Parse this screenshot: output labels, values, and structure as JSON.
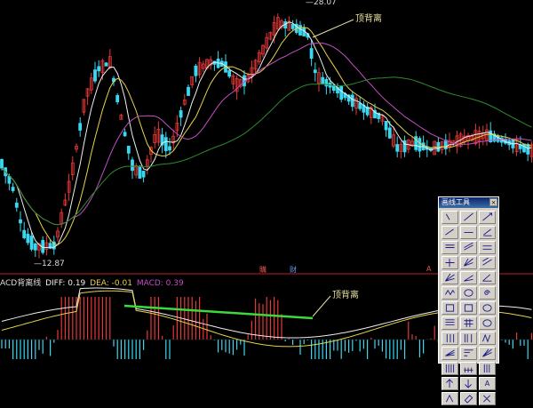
{
  "labels": {
    "price_high": "28.07",
    "price_low": "12.87",
    "top_divergence_upper": "顶背离",
    "top_divergence_lower": "顶背离",
    "macd_prefix": "ACD背离线",
    "diff": "DIFF: 0.19",
    "dea": "DEA: -0.01",
    "macd": "MACD: 0.39",
    "marker_1": "購",
    "marker_2": "财",
    "marker_3": "A"
  },
  "toolbox": {
    "title": "画线工具",
    "close": "×",
    "buttons": [
      {
        "name": "cursor-icon"
      },
      {
        "name": "line-icon"
      },
      {
        "name": "ray-icon"
      },
      {
        "name": "segment-icon"
      },
      {
        "name": "dashed-line-icon"
      },
      {
        "name": "arrow-line-icon"
      },
      {
        "name": "horizontal-line-icon"
      },
      {
        "name": "channel-icon"
      },
      {
        "name": "parallel-lines-icon"
      },
      {
        "name": "price-line-icon"
      },
      {
        "name": "fan-lines-icon"
      },
      {
        "name": "trend-channel-icon"
      },
      {
        "name": "gann-fan-icon"
      },
      {
        "name": "fib-fan-icon"
      },
      {
        "name": "angle-icon"
      },
      {
        "name": "wave-icon"
      },
      {
        "name": "circle-icon"
      },
      {
        "name": "spiral-icon"
      },
      {
        "name": "rectangle-icon"
      },
      {
        "name": "box-icon"
      },
      {
        "name": "ellipse-icon"
      },
      {
        "name": "fib-retrace-icon"
      },
      {
        "name": "grid-icon"
      },
      {
        "name": "cycle-icon"
      },
      {
        "name": "period-lines-icon"
      },
      {
        "name": "time-zone-icon"
      },
      {
        "name": "fib-time-icon"
      },
      {
        "name": "percent-lines-icon"
      },
      {
        "name": "gold-ratio-icon"
      },
      {
        "name": "speed-lines-icon"
      },
      {
        "name": "bar-lines-icon"
      },
      {
        "name": "tick-lines-icon"
      },
      {
        "name": "vertical-lines-icon"
      },
      {
        "name": "up-arrow-icon"
      },
      {
        "name": "down-arrow-icon"
      },
      {
        "name": "text-icon",
        "text": "A"
      },
      {
        "name": "palette-icon"
      },
      {
        "name": "eraser-icon"
      },
      {
        "name": "delete-icon"
      }
    ]
  },
  "colors": {
    "up": "#e53838",
    "down": "#3ad8f0",
    "ma5": "#f0f0f0",
    "ma10": "#e6d24a",
    "ma20": "#c24ec2",
    "ma60": "#2e8a2e",
    "diff": "#f0f0f0",
    "dea": "#e6d24a",
    "divergence": "#3cd83c",
    "separator": "#c02020"
  }
}
